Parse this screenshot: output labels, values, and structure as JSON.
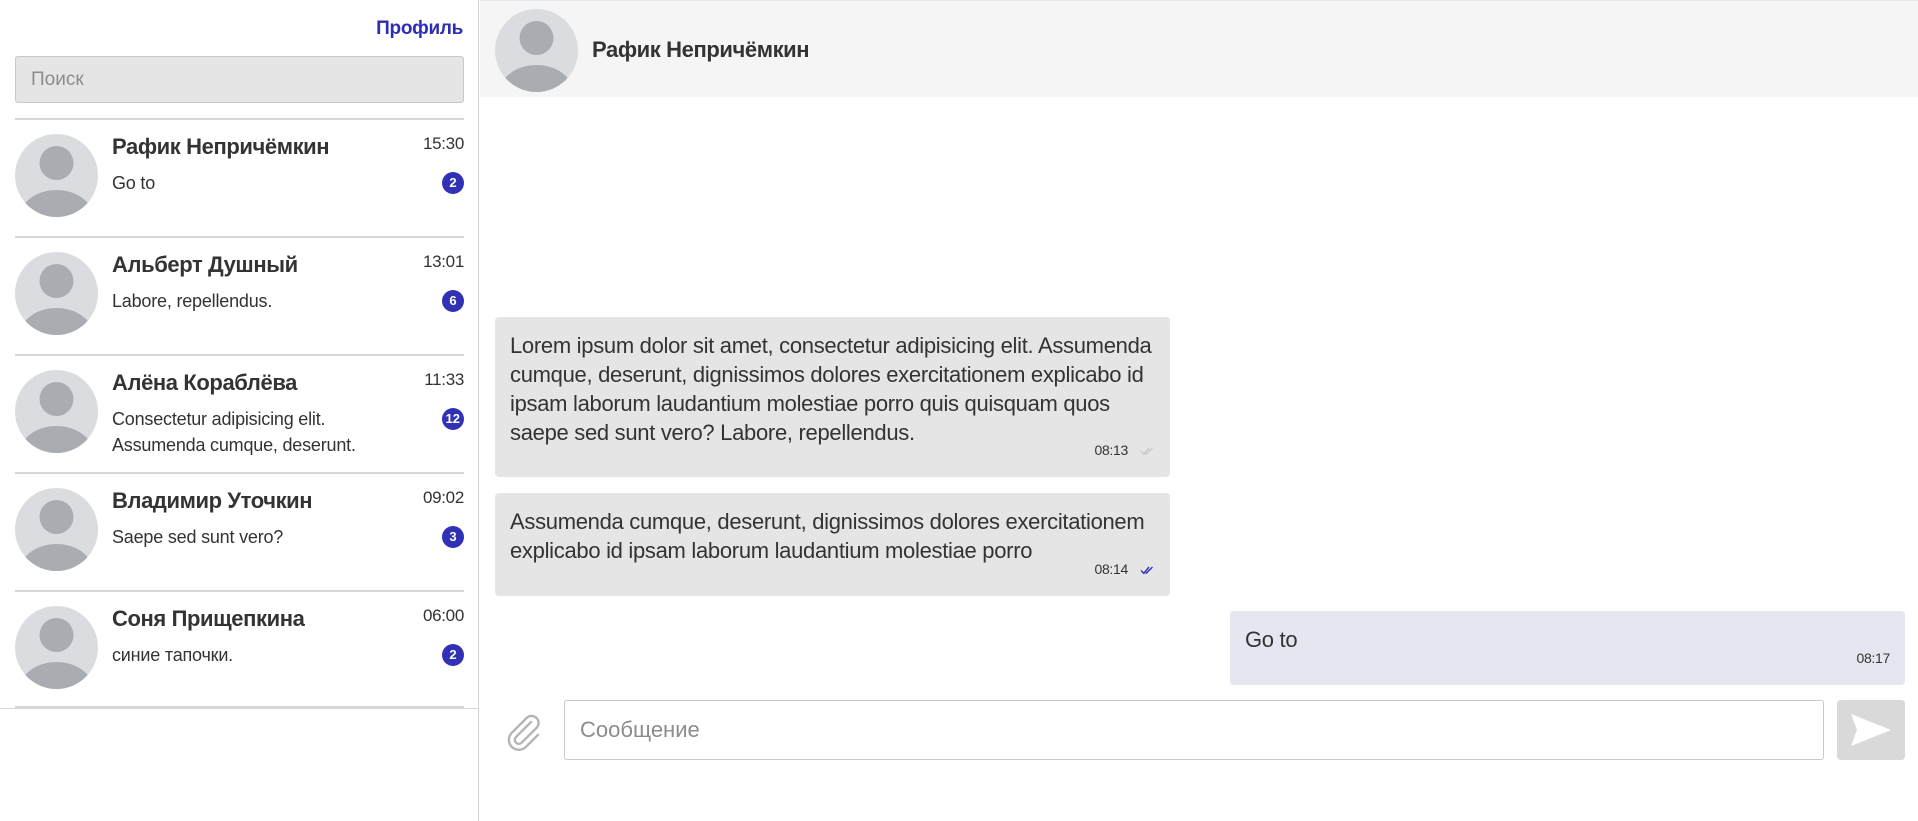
{
  "sidebar": {
    "profile_label": "Профиль",
    "search_placeholder": "Поиск",
    "chats": [
      {
        "name": "Рафик Непричёмкин",
        "preview": "Go to",
        "time": "15:30",
        "unread": "2"
      },
      {
        "name": "Альберт Душный",
        "preview": "Labore, repellendus.",
        "time": "13:01",
        "unread": "6"
      },
      {
        "name": "Алёна Кораблёва",
        "preview": "Consectetur adipisicing elit. Assumenda cumque, deserunt.",
        "time": "11:33",
        "unread": "12"
      },
      {
        "name": "Владимир Уточкин",
        "preview": "Saepe sed sunt vero?",
        "time": "09:02",
        "unread": "3"
      },
      {
        "name": "Соня Прищепкина",
        "preview": "синие тапочки.",
        "time": "06:00",
        "unread": "2"
      }
    ]
  },
  "conversation": {
    "title": "Рафик Непричёмкин",
    "messages": [
      {
        "direction": "in",
        "text": "Lorem ipsum dolor sit amet, consectetur adipisicing elit. Assumenda cumque, deserunt, dignissimos dolores exercitationem explicabo id ipsam laborum laudantium molestiae porro quis quisquam quos saepe sed sunt vero? Labore, repellendus.",
        "time": "08:13",
        "status": "delivered",
        "status_color": "#c8c8c8"
      },
      {
        "direction": "in",
        "text": "Assumenda cumque, deserunt, dignissimos dolores exercitationem explicabo id ipsam laborum laudantium molestiae porro",
        "time": "08:14",
        "status": "read",
        "status_color": "#3131b5"
      },
      {
        "direction": "out",
        "text": "Go to",
        "time": "08:17",
        "status": "",
        "status_color": ""
      }
    ],
    "composer": {
      "placeholder": "Сообщение",
      "attach_icon": "paperclip-icon",
      "send_icon": "send-arrow-icon"
    }
  },
  "colors": {
    "accent": "#3131b5",
    "incoming_bubble": "#e5e5e5",
    "outgoing_bubble": "#e6e6f0",
    "header_bg": "#f5f5f5"
  }
}
